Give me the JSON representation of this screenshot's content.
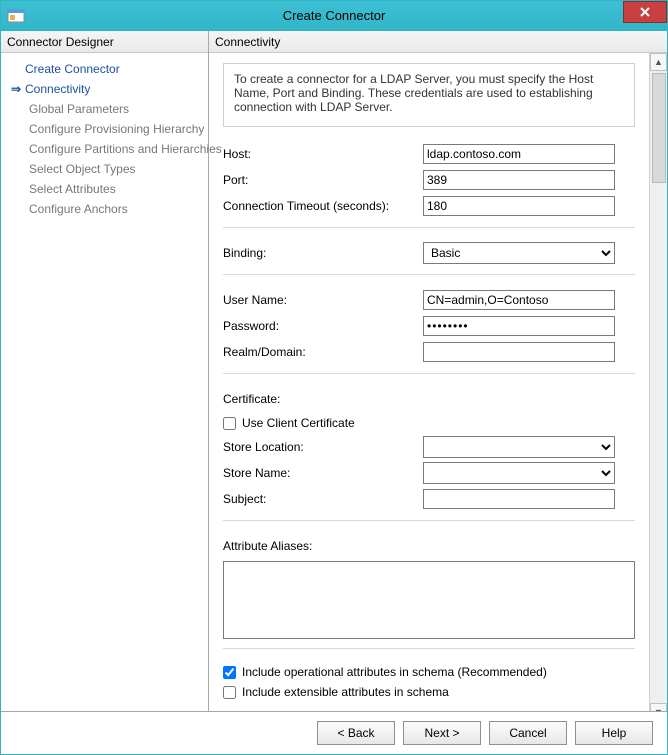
{
  "window": {
    "title": "Create Connector"
  },
  "sidepanel": {
    "header": "Connector Designer",
    "root": "Create Connector",
    "current": "Connectivity",
    "items": [
      "Global Parameters",
      "Configure Provisioning Hierarchy",
      "Configure Partitions and Hierarchies",
      "Select Object Types",
      "Select Attributes",
      "Configure Anchors"
    ]
  },
  "main": {
    "header": "Connectivity",
    "intro": "To create a connector for a LDAP Server, you must specify the Host Name, Port and Binding. These credentials are used to establishing connection with LDAP Server.",
    "host_label": "Host:",
    "host_value": "ldap.contoso.com",
    "port_label": "Port:",
    "port_value": "389",
    "timeout_label": "Connection Timeout (seconds):",
    "timeout_value": "180",
    "binding_label": "Binding:",
    "binding_value": "Basic",
    "user_label": "User Name:",
    "user_value": "CN=admin,O=Contoso",
    "pass_label": "Password:",
    "pass_value": "********",
    "realm_label": "Realm/Domain:",
    "realm_value": "",
    "cert_label": "Certificate:",
    "use_cert_label": "Use Client Certificate",
    "store_loc_label": "Store Location:",
    "store_name_label": "Store Name:",
    "subject_label": "Subject:",
    "aliases_label": "Attribute Aliases:",
    "inc_op_label": "Include operational attributes in schema (Recommended)",
    "inc_ext_label": "Include extensible attributes in schema"
  },
  "buttons": {
    "back": "<  Back",
    "next": "Next  >",
    "cancel": "Cancel",
    "help": "Help"
  }
}
